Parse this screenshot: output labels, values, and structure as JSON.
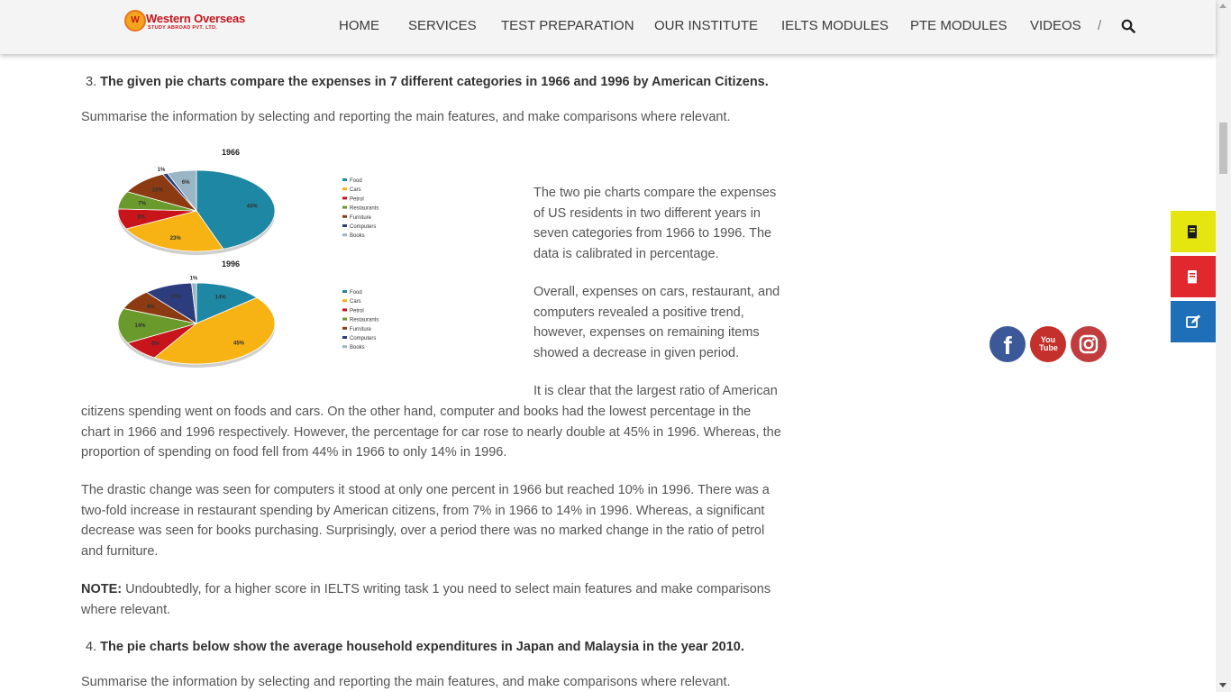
{
  "brand": {
    "logo_mark": "W",
    "name": "Western Overseas",
    "tagline": "STUDY ABROAD PVT. LTD."
  },
  "nav": {
    "items": [
      {
        "label": "HOME"
      },
      {
        "label": "SERVICES"
      },
      {
        "label": "TEST PREPARATION"
      },
      {
        "label": "OUR INSTITUTE"
      },
      {
        "label": "IELTS MODULES"
      },
      {
        "label": "PTE MODULES"
      },
      {
        "label": "VIDEOS"
      }
    ],
    "separator": "/",
    "search_icon": "search-icon"
  },
  "question3": {
    "number": "3.",
    "title": "The given pie charts compare the expenses in 7 different categories in 1966 and 1996 by American Citizens.",
    "instruction": "Summarise the information by selecting and reporting the main features, and make comparisons where relevant."
  },
  "essay": {
    "intro_lines": [
      "The two pie charts compare the expenses",
      "of US residents in two different years in",
      "seven categories from 1966 to 1996. The",
      "data is calibrated in percentage."
    ],
    "overview_lines": [
      "Overall, expenses on cars, restaurant, and",
      "computers revealed a positive trend,",
      "however, expenses on remaining items",
      "showed a decrease in given period."
    ],
    "body1_first": "It is clear that the largest ratio of American",
    "body1_lines": [
      "citizens spending went on foods and cars. On the other hand, computer and books had the lowest percentage in the",
      "chart in 1966 and 1996 respectively. However, the percentage for car rose to nearly double at 45% in 1996. Whereas, the",
      "proportion of spending on food fell from 44% in 1966 to only 14% in 1996."
    ],
    "body2_lines": [
      "The drastic change was seen for computers it stood at only one percent in 1966 but reached 10% in 1996. There was a",
      "two-fold increase in restaurant spending by American citizens, from 7% in 1966 to 14% in 1996. Whereas, a significant",
      "decrease was seen for books purchasing. Surprisingly, over a period there was no marked change in the ratio of petrol",
      "and furniture."
    ],
    "note_label": "NOTE:",
    "note_text": " Undoubtedly, for a higher score in IELTS writing task 1 you need to select main features and make comparisons",
    "note_line2": "where relevant."
  },
  "question4": {
    "number": "4.",
    "title": "The pie charts below show the average household expenditures in Japan and Malaysia in the year 2010.",
    "instruction": "Summarise the information by selecting and reporting the main features, and make comparisons where relevant."
  },
  "chart_data": [
    {
      "type": "pie",
      "title": "1966",
      "categories": [
        "Food",
        "Cars",
        "Petrol",
        "Restaurants",
        "Furniture",
        "Computers",
        "Books"
      ],
      "values": [
        44,
        23,
        8,
        7,
        10,
        1,
        6
      ],
      "labels": [
        "44%",
        "23%",
        "8%",
        "7%",
        "10%",
        "1%",
        "6%"
      ],
      "colors": [
        "#1e87a4",
        "#f7b213",
        "#c8141b",
        "#6a9a2c",
        "#8b3a12",
        "#2c3c7c",
        "#9ab5c6"
      ],
      "legend": "right"
    },
    {
      "type": "pie",
      "title": "1996",
      "categories": [
        "Food",
        "Cars",
        "Petrol",
        "Restaurants",
        "Furniture",
        "Computers",
        "Books"
      ],
      "values": [
        14,
        45,
        8,
        14,
        8,
        10,
        1
      ],
      "labels": [
        "14%",
        "45%",
        "8%",
        "14%",
        "8%",
        "10%",
        "1%"
      ],
      "colors": [
        "#1e87a4",
        "#f7b213",
        "#c8141b",
        "#6a9a2c",
        "#8b3a12",
        "#2c3c7c",
        "#9ab5c6"
      ],
      "legend": "right"
    }
  ],
  "social": {
    "facebook": {
      "icon": "facebook-icon",
      "glyph": "f",
      "color": "#3b5998"
    },
    "youtube": {
      "icon": "youtube-icon",
      "glyph": "You Tube",
      "color": "#c4302b"
    },
    "instagram": {
      "icon": "instagram-icon",
      "color": "#c13d3d"
    }
  },
  "side_buttons": [
    {
      "icon": "book-icon",
      "color": "#e5e510"
    },
    {
      "icon": "book-open-icon",
      "color": "#e0282e"
    },
    {
      "icon": "edit-icon",
      "color": "#1e6fb8"
    }
  ]
}
